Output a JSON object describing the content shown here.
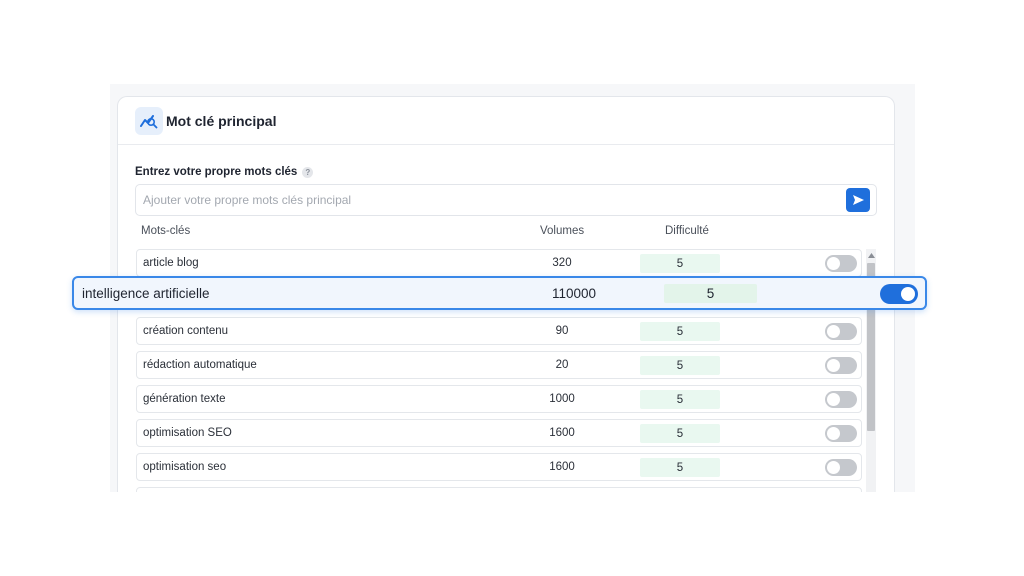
{
  "header": {
    "title": "Mot clé principal",
    "icon": "keyword-chart-icon"
  },
  "input": {
    "label": "Entrez votre propre mots clés",
    "help": "?",
    "placeholder": "Ajouter votre propre mots clés principal",
    "value": ""
  },
  "columns": {
    "keyword": "Mots-clés",
    "volume": "Volumes",
    "difficulty": "Difficulté"
  },
  "rows": [
    {
      "keyword": "article blog",
      "volume": "320",
      "difficulty": "5",
      "enabled": false
    },
    {
      "keyword": "intelligence artificielle",
      "volume": "110000",
      "difficulty": "5",
      "enabled": true
    },
    {
      "keyword": "création contenu",
      "volume": "90",
      "difficulty": "5",
      "enabled": false
    },
    {
      "keyword": "rédaction automatique",
      "volume": "20",
      "difficulty": "5",
      "enabled": false
    },
    {
      "keyword": "génération texte",
      "volume": "1000",
      "difficulty": "5",
      "enabled": false
    },
    {
      "keyword": "optimisation SEO",
      "volume": "1600",
      "difficulty": "5",
      "enabled": false
    },
    {
      "keyword": "optimisation seo",
      "volume": "1600",
      "difficulty": "5",
      "enabled": false
    }
  ],
  "colors": {
    "accent": "#1f6fdc",
    "difficulty_bg": "#e9f8f0",
    "highlight_border": "#3a88e8"
  }
}
